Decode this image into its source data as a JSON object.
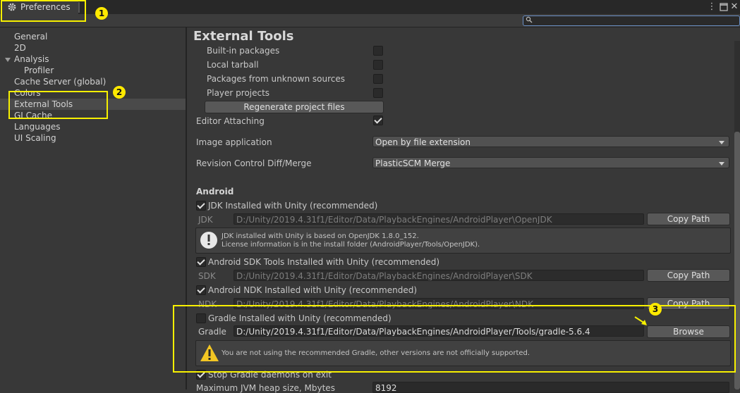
{
  "window": {
    "tab_title": "Preferences",
    "tab_icon": "gear-icon",
    "menu_icon": "kebab-menu-icon",
    "maximize_icon": "maximize-icon",
    "close_glyph": "✕"
  },
  "search": {
    "placeholder": "",
    "icon": "search-icon"
  },
  "sidebar": {
    "items": [
      {
        "label": "General"
      },
      {
        "label": "2D"
      },
      {
        "label": "Analysis"
      },
      {
        "label": "Profiler"
      },
      {
        "label": "Cache Server (global)"
      },
      {
        "label": "Colors"
      },
      {
        "label": "External Tools",
        "selected": true
      },
      {
        "label": "GI Cache"
      },
      {
        "label": "Languages"
      },
      {
        "label": "UI Scaling"
      }
    ]
  },
  "main": {
    "title": "External Tools",
    "generate_options": [
      {
        "label": "Built-in packages",
        "checked": false
      },
      {
        "label": "Local tarball",
        "checked": false
      },
      {
        "label": "Packages from unknown sources",
        "checked": false
      },
      {
        "label": "Player projects",
        "checked": false
      }
    ],
    "regenerate_label": "Regenerate project files",
    "editor_attaching": {
      "label": "Editor Attaching",
      "checked": true
    },
    "image_application": {
      "label": "Image application",
      "value": "Open by file extension"
    },
    "revision_control": {
      "label": "Revision Control Diff/Merge",
      "value": "PlasticSCM Merge"
    },
    "android": {
      "heading": "Android",
      "jdk": {
        "toggle_label": "JDK Installed with Unity (recommended)",
        "checked": true,
        "field_label": "JDK",
        "path": "D:/Unity/2019.4.31f1/Editor/Data/PlaybackEngines/AndroidPlayer\\OpenJDK",
        "button_label": "Copy Path",
        "info_line1": "JDK installed with Unity is based on OpenJDK 1.8.0_152.",
        "info_line2": "License information is in the install folder (AndroidPlayer/Tools/OpenJDK)."
      },
      "sdk": {
        "toggle_label": "Android SDK Tools Installed with Unity (recommended)",
        "checked": true,
        "field_label": "SDK",
        "path": "D:/Unity/2019.4.31f1/Editor/Data/PlaybackEngines/AndroidPlayer\\SDK",
        "button_label": "Copy Path"
      },
      "ndk": {
        "toggle_label": "Android NDK Installed with Unity (recommended)",
        "checked": true,
        "field_label": "NDK",
        "path": "D:/Unity/2019.4.31f1/Editor/Data/PlaybackEngines/AndroidPlayer\\NDK",
        "button_label": "Copy Path"
      },
      "gradle": {
        "toggle_label": "Gradle Installed with Unity (recommended)",
        "checked": false,
        "field_label": "Gradle",
        "path": "D:/Unity/2019.4.31f1/Editor/Data/PlaybackEngines/AndroidPlayer/Tools/gradle-5.6.4",
        "button_label": "Browse",
        "warning": "You are not using the recommended Gradle, other versions are not officially supported."
      },
      "stop_gradle": {
        "label": "Stop Gradle daemons on exit",
        "checked": true
      },
      "jvm_heap": {
        "label": "Maximum JVM heap size, Mbytes",
        "value": "8192"
      }
    }
  },
  "annotations": {
    "badge1": "1",
    "badge2": "2",
    "badge3": "3",
    "color": "#f7f000"
  }
}
